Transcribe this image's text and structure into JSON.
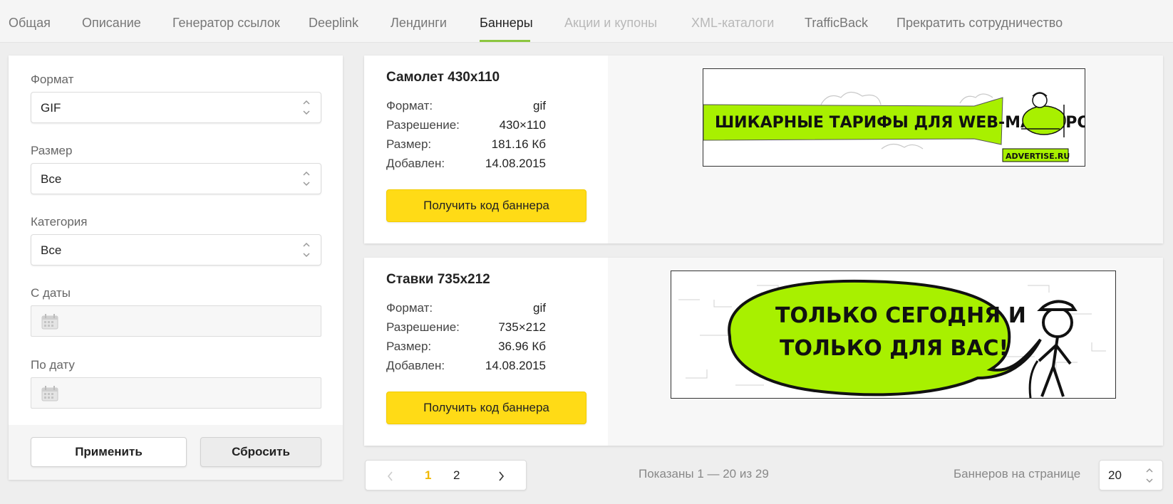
{
  "tabs": [
    {
      "label": "Общая",
      "state": "normal"
    },
    {
      "label": "Описание",
      "state": "normal"
    },
    {
      "label": "Генератор ссылок",
      "state": "normal"
    },
    {
      "label": "Deeplink",
      "state": "normal"
    },
    {
      "label": "Лендинги",
      "state": "normal"
    },
    {
      "label": "Баннеры",
      "state": "active"
    },
    {
      "label": "Акции и купоны",
      "state": "disabled"
    },
    {
      "label": "XML-каталоги",
      "state": "disabled"
    },
    {
      "label": "TrafficBack",
      "state": "normal"
    },
    {
      "label": "Прекратить сотрудничество",
      "state": "normal"
    }
  ],
  "filters": {
    "format": {
      "label": "Формат",
      "value": "GIF"
    },
    "size": {
      "label": "Размер",
      "value": "Все"
    },
    "category": {
      "label": "Категория",
      "value": "Все"
    },
    "date_from": {
      "label": "С даты",
      "value": ""
    },
    "date_to": {
      "label": "По дату",
      "value": ""
    },
    "apply_label": "Применить",
    "reset_label": "Сбросить"
  },
  "banners": [
    {
      "title": "Самолет 430x110",
      "format_key": "Формат:",
      "format": "gif",
      "resolution_key": "Разрешение:",
      "resolution": "430×110",
      "size_key": "Размер:",
      "size": "181.16 Кб",
      "added_key": "Добавлен:",
      "added": "14.08.2015",
      "button_label": "Получить код баннера",
      "image_text": "ШИКАРНЫЕ ТАРИФЫ ДЛЯ WEB-МАСТЕРОВ!",
      "image_logo": "ADVERTISE.RU"
    },
    {
      "title": "Ставки 735x212",
      "format_key": "Формат:",
      "format": "gif",
      "resolution_key": "Разрешение:",
      "resolution": "735×212",
      "size_key": "Размер:",
      "size": "36.96 Кб",
      "added_key": "Добавлен:",
      "added": "14.08.2015",
      "button_label": "Получить код баннера",
      "image_text_line1": "ТОЛЬКО СЕГОДНЯ И",
      "image_text_line2": "ТОЛЬКО ДЛЯ ВАС!"
    }
  ],
  "pagination": {
    "pages": [
      "1",
      "2"
    ],
    "current": "1",
    "shown": "Показаны 1 — 20 из 29",
    "per_page_label": "Баннеров на странице",
    "per_page_value": "20"
  },
  "colors": {
    "accent_green": "#8cc63f",
    "button_yellow": "#ffdb16",
    "current_page": "#f0b800",
    "banner_green": "#a8f000"
  }
}
